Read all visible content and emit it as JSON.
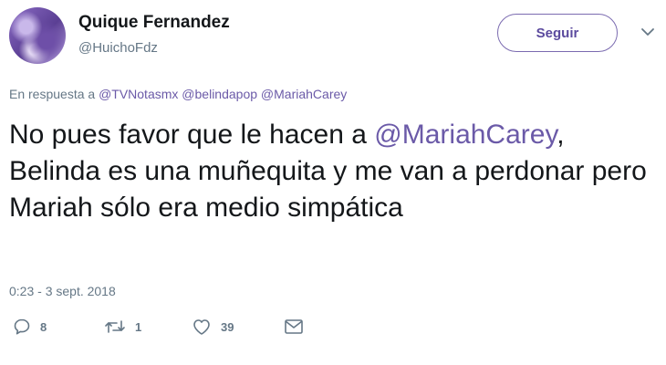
{
  "user": {
    "name": "Quique Fernandez",
    "handle": "@HuichoFdz"
  },
  "follow_label": "Seguir",
  "reply": {
    "prefix": "En respuesta a",
    "mentions": [
      "@TVNotasmx",
      "@belindapop",
      "@MariahCarey"
    ]
  },
  "tweet": {
    "text_before": "No pues favor que le hacen a ",
    "mention": "@MariahCarey",
    "text_after": ", Belinda es una muñequita y me van a perdonar pero Mariah sólo era medio simpática"
  },
  "timestamp": "0:23 - 3 sept. 2018",
  "actions": {
    "replies": "8",
    "retweets": "1",
    "likes": "39"
  },
  "colors": {
    "accent": "#6b5aa8",
    "muted": "#657786",
    "text": "#14171a"
  },
  "icons": [
    "reply-icon",
    "retweet-icon",
    "like-icon",
    "message-icon",
    "chevron-down-icon"
  ]
}
